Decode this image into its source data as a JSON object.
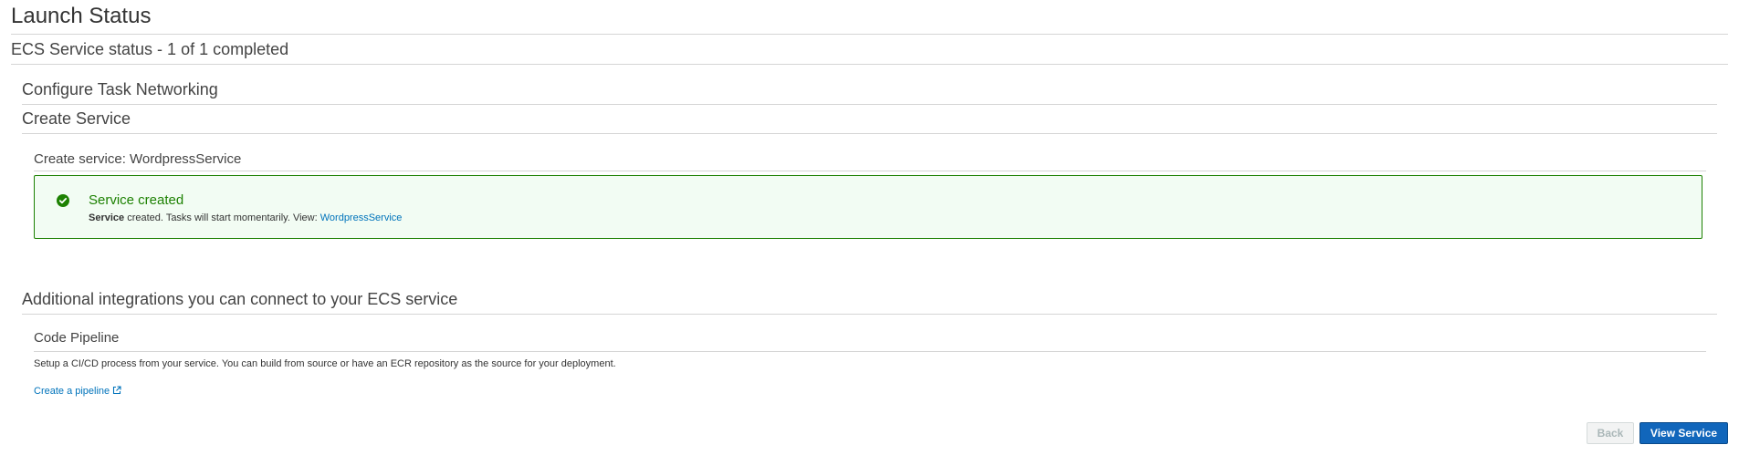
{
  "page": {
    "title": "Launch Status",
    "status_heading": "ECS Service status - 1 of 1 completed"
  },
  "steps": [
    {
      "label": "Configure Task Networking"
    },
    {
      "label": "Create Service"
    }
  ],
  "create_service": {
    "subheading": "Create service: WordpressService",
    "alert": {
      "type": "success",
      "icon": "check-circle-icon",
      "title": "Service created",
      "message_bold": "Service",
      "message_rest": " created. Tasks will start momentarily. View: ",
      "link_text": "WordpressService"
    }
  },
  "integrations": {
    "heading": "Additional integrations you can connect to your ECS service",
    "code_pipeline": {
      "title": "Code Pipeline",
      "description": "Setup a CI/CD process from your service. You can build from source or have an ECR repository as the source for your deployment.",
      "link_text": "Create a pipeline",
      "link_icon": "external-link-icon"
    }
  },
  "footer": {
    "back_label": "Back",
    "back_state": "disabled",
    "view_service_label": "View Service"
  },
  "colors": {
    "success": "#1d8102",
    "success_bg": "#f2fcf3",
    "link": "#0073bb",
    "primary_button": "#1166bb"
  }
}
